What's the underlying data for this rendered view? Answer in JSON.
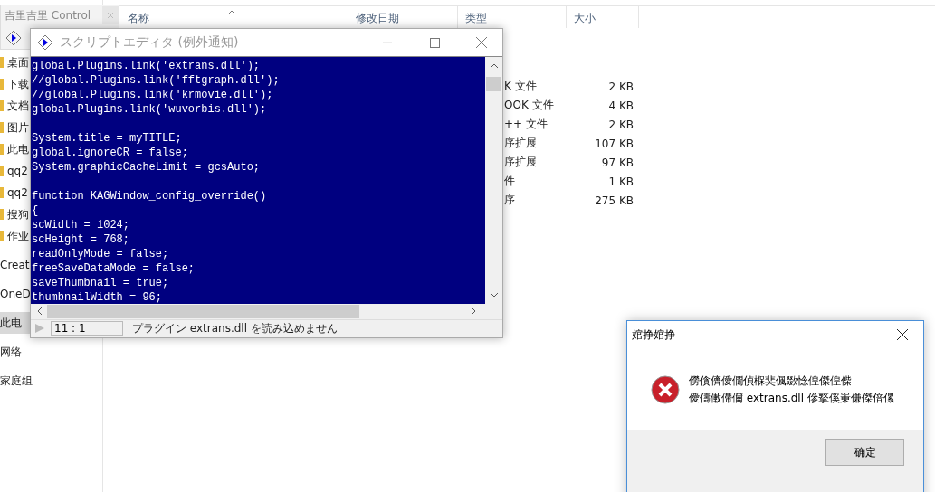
{
  "explorer": {
    "nav_items": [
      {
        "label": "桌面",
        "kind": "pinned",
        "selected": false
      },
      {
        "label": "下载",
        "kind": "pinned",
        "selected": false
      },
      {
        "label": "文档",
        "kind": "pinned",
        "selected": false
      },
      {
        "label": "图片",
        "kind": "pinned",
        "selected": false
      },
      {
        "label": "此电",
        "kind": "pinned",
        "selected": false
      },
      {
        "label": "qq2",
        "kind": "pinned",
        "selected": false
      },
      {
        "label": "qq2",
        "kind": "pinned",
        "selected": false
      },
      {
        "label": "搜狗",
        "kind": "pinned",
        "selected": false
      },
      {
        "label": "作业",
        "kind": "pinned",
        "selected": false
      },
      {
        "label": "Creat",
        "kind": "root",
        "selected": false
      },
      {
        "label": "OneD",
        "kind": "root",
        "selected": false
      },
      {
        "label": "此电",
        "kind": "root",
        "selected": true
      },
      {
        "label": "网络",
        "kind": "root",
        "selected": false
      },
      {
        "label": "家庭组",
        "kind": "root",
        "selected": false
      }
    ],
    "columns": [
      {
        "label": "名称",
        "sorted": true
      },
      {
        "label": "修改日期",
        "sorted": false
      },
      {
        "label": "类型",
        "sorted": false
      },
      {
        "label": "大小",
        "sorted": false
      }
    ],
    "rows": [
      {
        "type": "K 文件",
        "size": "2 KB"
      },
      {
        "type": "OOK 文件",
        "size": "4 KB"
      },
      {
        "type": "++ 文件",
        "size": "2 KB"
      },
      {
        "type": "序扩展",
        "size": "107 KB"
      },
      {
        "type": "序扩展",
        "size": "97 KB"
      },
      {
        "type": "件",
        "size": "1 KB"
      },
      {
        "type": "序",
        "size": "275 KB"
      }
    ]
  },
  "control_window": {
    "title": "吉里吉里 Control"
  },
  "script_editor": {
    "title": "スクリプトエディタ (例外通知)",
    "code_blocks": [
      [
        "global.Plugins.link('extrans.dll');",
        "//global.Plugins.link('fftgraph.dll');",
        "//global.Plugins.link('krmovie.dll');",
        "global.Plugins.link('wuvorbis.dll');"
      ],
      [
        "System.title = myTITLE;",
        "global.ignoreCR = false;",
        "System.graphicCacheLimit = gcsAuto;"
      ],
      [
        "function KAGWindow_config_override()",
        "{",
        "scWidth = 1024;",
        "scHeight = 768;",
        "readOnlyMode = false;",
        "freeSaveDataMode = false;",
        "saveThumbnail = true;",
        "thumbnailWidth = 96;"
      ]
    ],
    "cursor_position": "11 : 1",
    "status_message": "プラグイン extrans.dll を読み込めません"
  },
  "error_dialog": {
    "title": "婠挣婠挣",
    "message_lines": [
      "僗僋儕僾僩偵椺奜偑敪惗偟傑偟偨",
      "僾儔僌僀儞 extrans.dll 傪撉傒崬傔傑偣傫"
    ],
    "button": "确定"
  }
}
